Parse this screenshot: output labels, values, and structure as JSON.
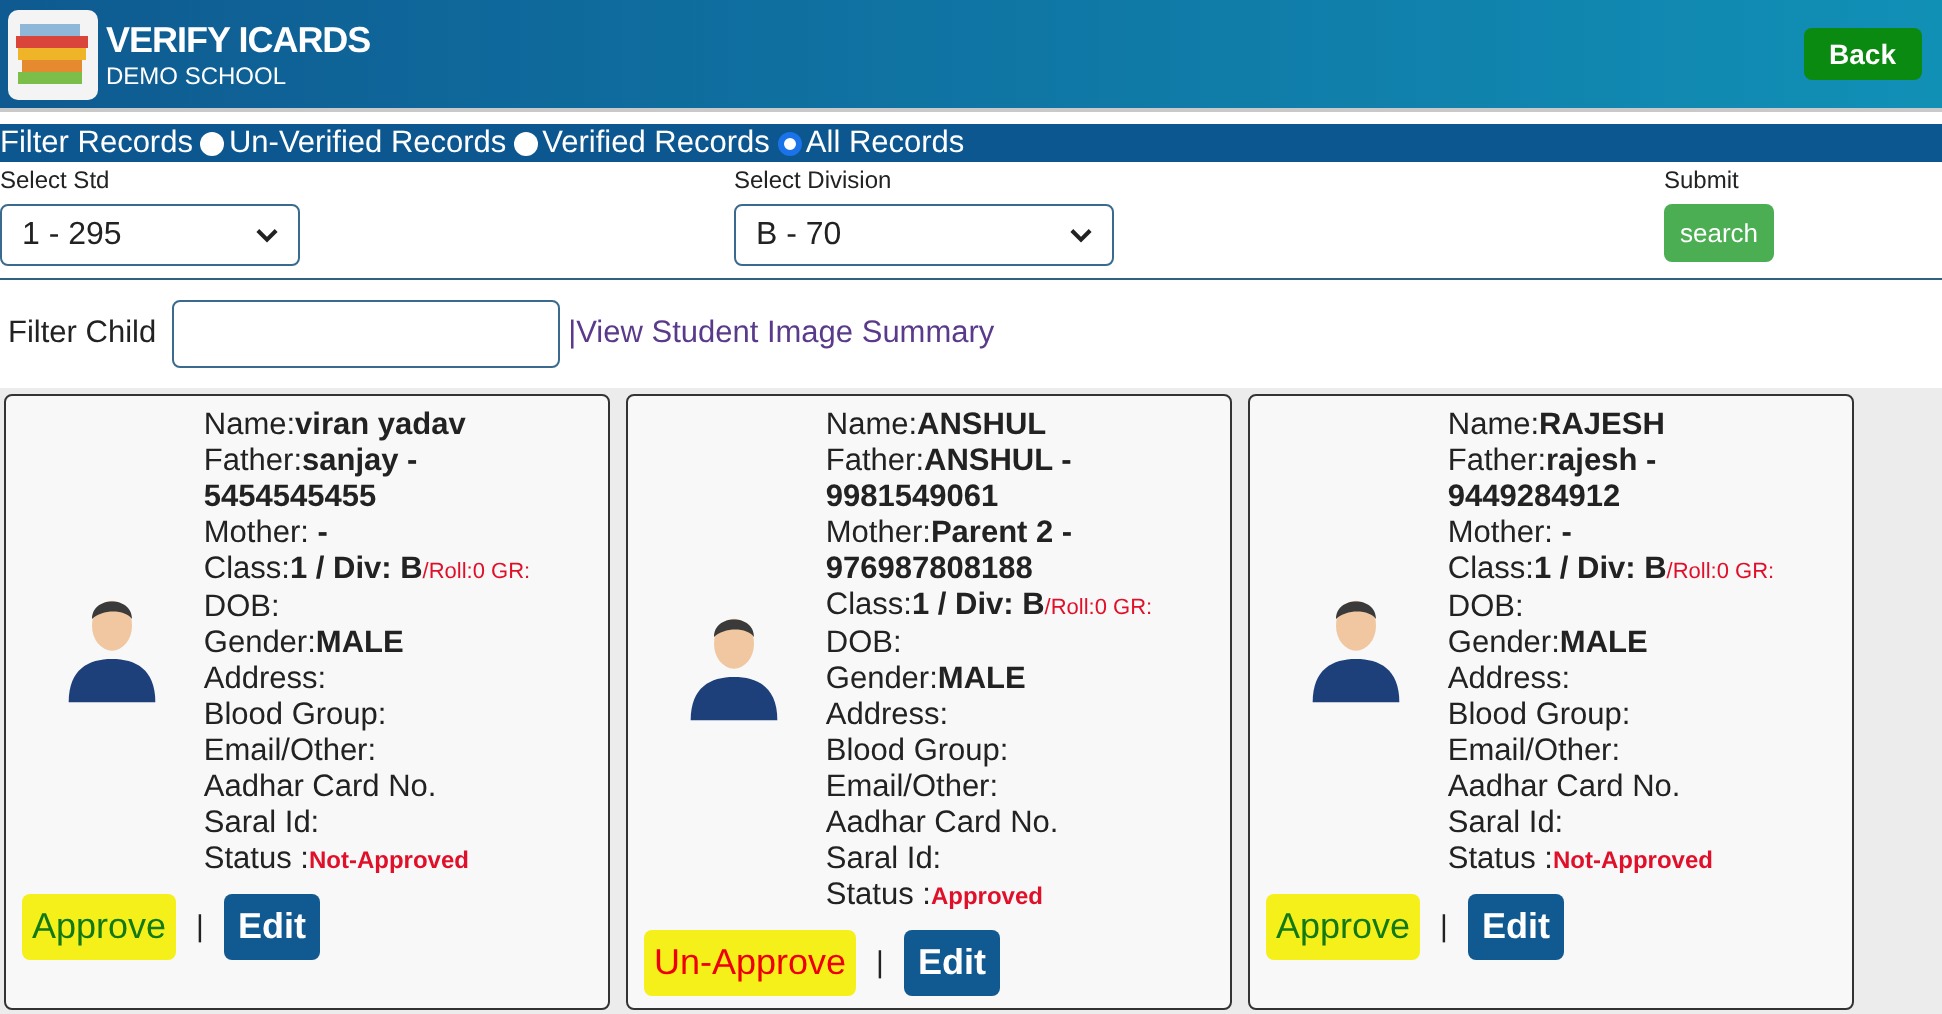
{
  "header": {
    "title": "VERIFY ICARDS",
    "subtitle": "DEMO SCHOOL",
    "back_button": "Back"
  },
  "filter_records": {
    "label": "Filter Records",
    "options": [
      {
        "label": "Un-Verified Records",
        "selected": false
      },
      {
        "label": "Verified Records",
        "selected": false
      },
      {
        "label": "All Records",
        "selected": true
      }
    ]
  },
  "selectors": [
    {
      "label": "Select Std",
      "value": "1 - 295"
    },
    {
      "label": "Select Division",
      "value": "B - 70"
    }
  ],
  "submit": {
    "label": "Submit",
    "button": "search"
  },
  "filter_child": {
    "label": "Filter Child",
    "link": "|View Student Image Summary"
  },
  "students": [
    {
      "fields": [
        {
          "kind": "plain",
          "label": "Name:",
          "value": "viran yadav"
        },
        {
          "kind": "plain",
          "label": "Father:",
          "value": "sanjay - 5454545455"
        },
        {
          "kind": "plain",
          "label": "Mother: **-**"
        },
        {
          "kind": "class",
          "label": "Class:",
          "value": "1 / Div: B",
          "note": "/Roll:0 GR:"
        },
        {
          "kind": "plain",
          "label": "DOB:"
        },
        {
          "kind": "plain",
          "label": "Gender:",
          "value": "MALE"
        },
        {
          "kind": "plain",
          "label": "Address:"
        },
        {
          "kind": "plain",
          "label": "Blood Group:"
        },
        {
          "kind": "plain",
          "label": "Email/Other:"
        },
        {
          "kind": "plain",
          "label": "Aadhar Card No."
        },
        {
          "kind": "plain",
          "label": "Saral Id:"
        },
        {
          "kind": "status",
          "label": "Status :",
          "value": "Not-Approved"
        }
      ],
      "action": {
        "kind": "approve",
        "label": "Approve"
      },
      "separator": "|",
      "edit": "Edit"
    },
    {
      "fields": [
        {
          "kind": "plain",
          "label": "Name:",
          "value": "ANSHUL"
        },
        {
          "kind": "plain",
          "label": "Father:",
          "value": "ANSHUL - 9981549061"
        },
        {
          "kind": "plain",
          "label": "Mother:",
          "value": "Parent 2 - 976987808188"
        },
        {
          "kind": "class",
          "label": "Class:",
          "value": "1 / Div: B",
          "note": "/Roll:0 GR:"
        },
        {
          "kind": "plain",
          "label": "DOB:"
        },
        {
          "kind": "plain",
          "label": "Gender:",
          "value": "MALE"
        },
        {
          "kind": "plain",
          "label": "Address:"
        },
        {
          "kind": "plain",
          "label": "Blood Group:"
        },
        {
          "kind": "plain",
          "label": "Email/Other:"
        },
        {
          "kind": "plain",
          "label": "Aadhar Card No."
        },
        {
          "kind": "plain",
          "label": "Saral Id:"
        },
        {
          "kind": "status",
          "label": "Status :",
          "value": "Approved"
        }
      ],
      "action": {
        "kind": "unapprove",
        "label": "Un-Approve"
      },
      "separator": "|",
      "edit": "Edit"
    },
    {
      "fields": [
        {
          "kind": "plain",
          "label": "Name:",
          "value": "RAJESH"
        },
        {
          "kind": "plain",
          "label": "Father:",
          "value": "rajesh - 9449284912"
        },
        {
          "kind": "plain",
          "label": "Mother: **-**"
        },
        {
          "kind": "class",
          "label": "Class:",
          "value": "1 / Div: B",
          "note": "/Roll:0 GR:"
        },
        {
          "kind": "plain",
          "label": "DOB:"
        },
        {
          "kind": "plain",
          "label": "Gender:",
          "value": "MALE"
        },
        {
          "kind": "plain",
          "label": "Address:"
        },
        {
          "kind": "plain",
          "label": "Blood Group:"
        },
        {
          "kind": "plain",
          "label": "Email/Other:"
        },
        {
          "kind": "plain",
          "label": "Aadhar Card No."
        },
        {
          "kind": "plain",
          "label": "Saral Id:"
        },
        {
          "kind": "status",
          "label": "Status :",
          "value": "Not-Approved"
        }
      ],
      "action": {
        "kind": "approve",
        "label": "Approve"
      },
      "separator": "|",
      "edit": "Edit"
    }
  ]
}
